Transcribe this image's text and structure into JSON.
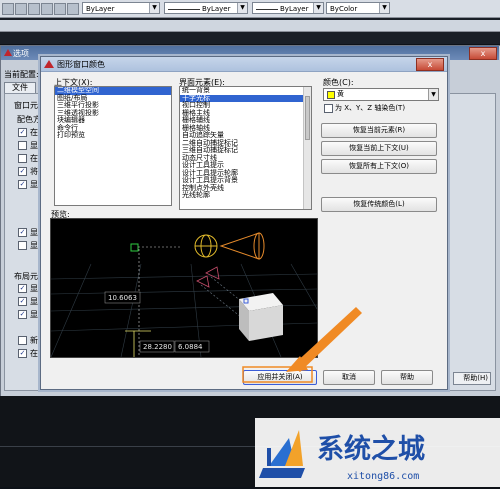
{
  "toolbar": {
    "layer_combo_1": "ByLayer",
    "layer_combo_2": "ByLayer",
    "layer_combo_3": "ByLayer",
    "color_combo": "ByColor"
  },
  "background_window": {
    "title_fragment": "选项",
    "current_profile_label": "当前配置:",
    "tab_file": "文件",
    "section_window": "窗口元",
    "section_color": "配色方",
    "section_layout": "布局元",
    "checkbox_labels": [
      "在",
      "显",
      "在",
      "将",
      "显",
      "显",
      "显",
      "显",
      "显",
      "显",
      "新",
      "在"
    ],
    "help_fragment": "帮助(H)"
  },
  "dialog": {
    "title": "图形窗口颜色",
    "close_symbol": "x",
    "context_label": "上下文(X):",
    "contexts": [
      "二维模型空间",
      "图纸/布局",
      "三维平行投影",
      "三维透视投影",
      "块编辑器",
      "命令行",
      "打印预览"
    ],
    "interface_label": "界面元素(E):",
    "interface_elements": [
      "统一背景",
      "十字光标",
      "视口控制",
      "栅格主线",
      "栅格辅线",
      "栅格轴线",
      "自动追踪矢量",
      "二维自动捕捉标记",
      "三维自动捕捉标记",
      "动态尺寸线",
      "设计工具提示",
      "设计工具提示轮廓",
      "设计工具提示背景",
      "控制点外壳线",
      "光线轮廓"
    ],
    "color_label": "颜色(C):",
    "color_value": "黄",
    "tint_checkbox_label": "为 X、Y、Z 轴染色(T)",
    "restore_element": "恢复当前元素(R)",
    "restore_context": "恢复当前上下文(U)",
    "restore_all": "恢复所有上下文(O)",
    "restore_classic": "恢复传统颜色(L)",
    "preview_label": "预览:",
    "preview_values": [
      "10.6063",
      "28.2280",
      "6.0884"
    ],
    "apply_close": "应用并关闭(A)",
    "cancel": "取消",
    "help": "帮助"
  },
  "watermark": {
    "brand": "系统之城",
    "url": "xitong86.com"
  }
}
